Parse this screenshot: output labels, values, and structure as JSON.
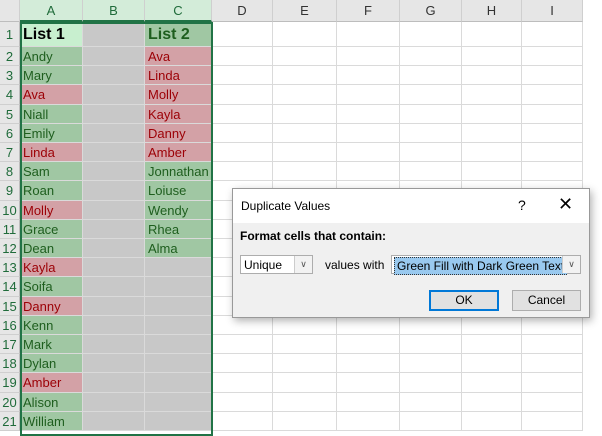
{
  "columns": [
    "A",
    "B",
    "C",
    "D",
    "E",
    "F",
    "G",
    "H",
    "I"
  ],
  "rows": [
    "1",
    "2",
    "3",
    "4",
    "5",
    "6",
    "7",
    "8",
    "9",
    "10",
    "11",
    "12",
    "13",
    "14",
    "15",
    "16",
    "17",
    "18",
    "19",
    "20",
    "21"
  ],
  "list1": [
    {
      "v": "List 1",
      "s": "hdrA"
    },
    {
      "v": "Andy",
      "s": "g"
    },
    {
      "v": "Mary",
      "s": "g"
    },
    {
      "v": "Ava",
      "s": "r"
    },
    {
      "v": "Niall",
      "s": "g"
    },
    {
      "v": "Emily",
      "s": "g"
    },
    {
      "v": "Linda",
      "s": "r"
    },
    {
      "v": "Sam",
      "s": "g"
    },
    {
      "v": "Roan",
      "s": "g"
    },
    {
      "v": "Molly",
      "s": "r"
    },
    {
      "v": "Grace",
      "s": "g"
    },
    {
      "v": "Dean",
      "s": "g"
    },
    {
      "v": "Kayla",
      "s": "r"
    },
    {
      "v": "Soifa",
      "s": "g"
    },
    {
      "v": "Danny",
      "s": "r"
    },
    {
      "v": "Kenn",
      "s": "g"
    },
    {
      "v": "Mark",
      "s": "g"
    },
    {
      "v": "Dylan",
      "s": "g"
    },
    {
      "v": "Amber",
      "s": "r"
    },
    {
      "v": "Alison",
      "s": "g"
    },
    {
      "v": "William",
      "s": "g"
    }
  ],
  "list2": [
    {
      "v": "List 2",
      "s": "g"
    },
    {
      "v": "Ava",
      "s": "r"
    },
    {
      "v": "Linda",
      "s": "r"
    },
    {
      "v": "Molly",
      "s": "r"
    },
    {
      "v": "Kayla",
      "s": "r"
    },
    {
      "v": "Danny",
      "s": "r"
    },
    {
      "v": "Amber",
      "s": "r"
    },
    {
      "v": "Jonnathan",
      "s": "g"
    },
    {
      "v": "Loiuse",
      "s": "g"
    },
    {
      "v": "Wendy",
      "s": "g"
    },
    {
      "v": "Rhea",
      "s": "g"
    },
    {
      "v": "Alma",
      "s": "g"
    }
  ],
  "colors": {
    "unique_fill": "#a0c7a3",
    "unique_text": "#1e5e1e",
    "dup_fill": "#d3a1a6",
    "dup_text": "#9c0006",
    "selection": "#217346"
  },
  "dialog": {
    "title": "Duplicate Values",
    "help": "?",
    "close": "✕",
    "label": "Format cells that contain:",
    "type_value": "Unique",
    "values_with": "values with",
    "format_value": "Green Fill with Dark Green Text",
    "ok": "OK",
    "cancel": "Cancel"
  }
}
